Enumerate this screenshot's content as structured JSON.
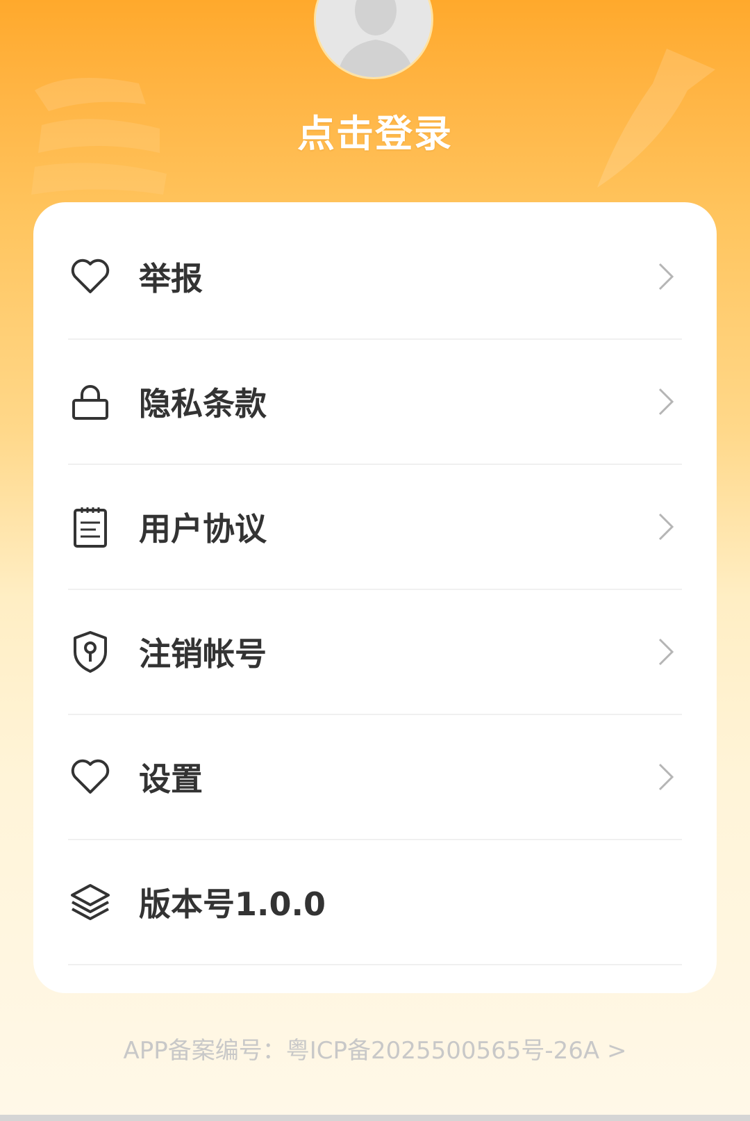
{
  "header": {
    "login_text": "点击登录"
  },
  "menu": {
    "items": [
      {
        "label": "举报",
        "icon": "heart-icon",
        "has_chevron": true
      },
      {
        "label": "隐私条款",
        "icon": "lock-icon",
        "has_chevron": true
      },
      {
        "label": "用户协议",
        "icon": "notepad-icon",
        "has_chevron": true
      },
      {
        "label": "注销帐号",
        "icon": "shield-key-icon",
        "has_chevron": true
      },
      {
        "label": "设置",
        "icon": "heart-icon",
        "has_chevron": true
      },
      {
        "label": "版本号1.0.0",
        "icon": "layers-icon",
        "has_chevron": false
      }
    ]
  },
  "footer": {
    "icp_text": "APP备案编号：粤ICP备2025500565号-26A >"
  },
  "colors": {
    "header_orange": "#FFA92C",
    "card_bg": "#FFFFFF",
    "label_text": "#333333",
    "footer_text": "#C8C8C8"
  }
}
